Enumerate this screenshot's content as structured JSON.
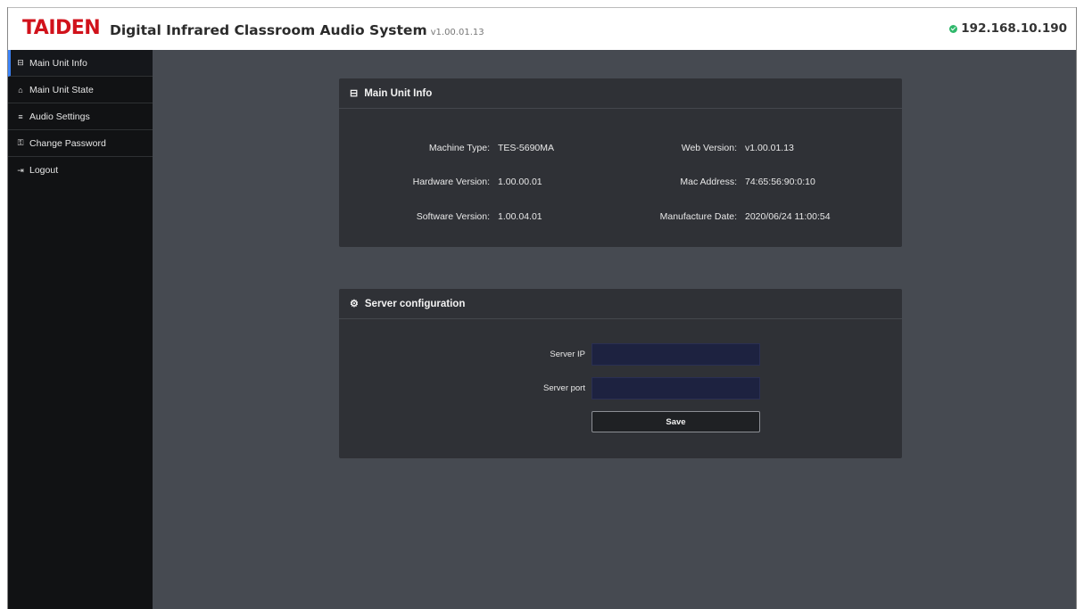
{
  "header": {
    "brand": "TAIDEN",
    "title": "Digital Infrared Classroom Audio System",
    "version": "v1.00.01.13",
    "ip": "192.168.10.190",
    "ip_status_color": "#2fb86b"
  },
  "sidebar": {
    "items": [
      {
        "label": "Main Unit Info",
        "icon": "monitor-icon",
        "glyph": "⊟"
      },
      {
        "label": "Main Unit State",
        "icon": "home-icon",
        "glyph": "⌂"
      },
      {
        "label": "Audio Settings",
        "icon": "sliders-icon",
        "glyph": "≡"
      },
      {
        "label": "Change Password",
        "icon": "key-icon",
        "glyph": "⚿"
      },
      {
        "label": "Logout",
        "icon": "logout-icon",
        "glyph": "⇥"
      }
    ],
    "active_index": 0
  },
  "unit_info": {
    "title": "Main Unit Info",
    "machine_type_label": "Machine Type:",
    "machine_type": "TES-5690MA",
    "hardware_version_label": "Hardware Version:",
    "hardware_version": "1.00.00.01",
    "software_version_label": "Software Version:",
    "software_version": "1.00.04.01",
    "web_version_label": "Web Version:",
    "web_version": "v1.00.01.13",
    "mac_address_label": "Mac Address:",
    "mac_address": "74:65:56:90:0:10",
    "manufacture_date_label": "Manufacture Date:",
    "manufacture_date": "2020/06/24 11:00:54"
  },
  "server_config": {
    "title": "Server configuration",
    "server_ip_label": "Server IP",
    "server_ip_value": "",
    "server_port_label": "Server port",
    "server_port_value": "",
    "save_label": "Save"
  },
  "colors": {
    "brand": "#d1121b",
    "sidebar_bg": "#111214",
    "content_bg": "#464a51",
    "card_bg": "#2f3136",
    "input_bg": "#1d2240",
    "active_accent": "#3b82f6"
  }
}
